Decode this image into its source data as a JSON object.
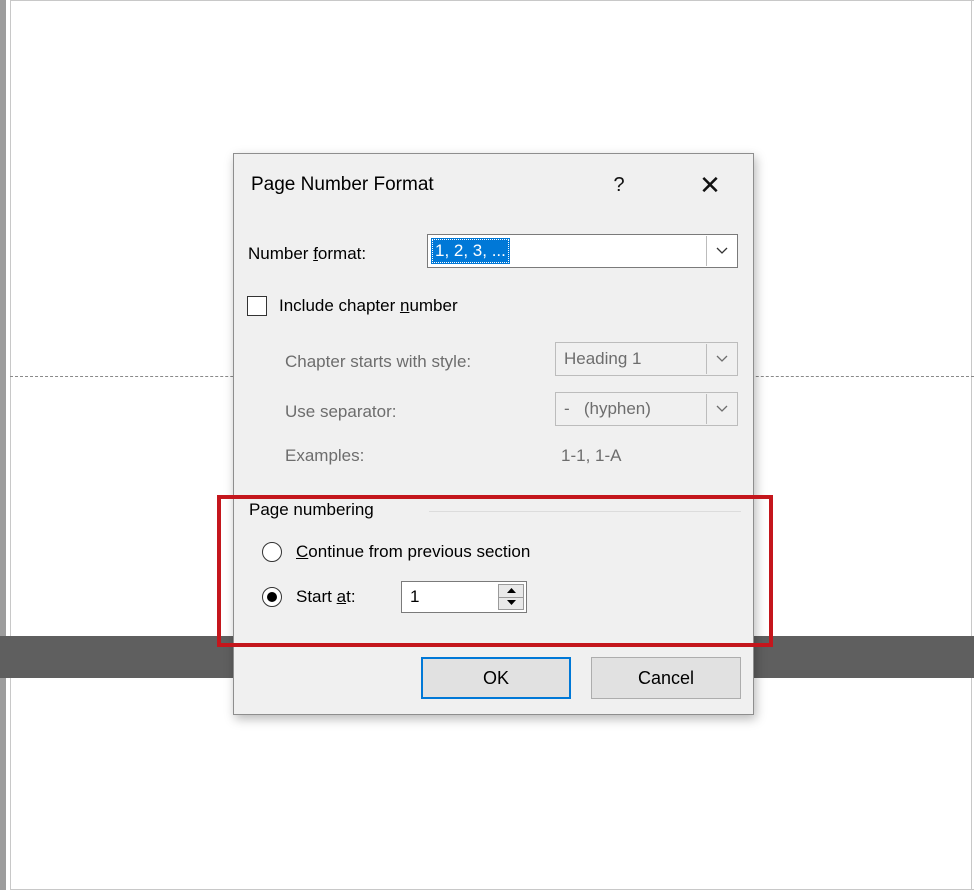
{
  "dialog": {
    "title": "Page Number Format",
    "help_label": "?",
    "close_label": "✕",
    "number_format": {
      "label_pre": "Number ",
      "label_accel": "f",
      "label_post": "ormat:",
      "value": "1, 2, 3, ..."
    },
    "include_chapter": {
      "label_pre": "Include chapter ",
      "label_accel": "n",
      "label_post": "umber",
      "checked": false
    },
    "chapter_style": {
      "label": "Chapter starts with style:",
      "value": "Heading 1"
    },
    "separator": {
      "label": "Use separator:",
      "value": "-   (hyphen)"
    },
    "examples": {
      "label": "Examples:",
      "value": "1-1, 1-A"
    },
    "page_numbering": {
      "group_title": "Page numbering",
      "continue": {
        "label_accel": "C",
        "label_post": "ontinue from previous section",
        "selected": false
      },
      "start_at": {
        "label_pre": "Start ",
        "label_accel": "a",
        "label_post": "t:",
        "selected": true,
        "value": "1"
      }
    },
    "buttons": {
      "ok": "OK",
      "cancel": "Cancel"
    }
  },
  "colors": {
    "annotation": "#c4161c",
    "selection": "#0078d7",
    "dialog_bg": "#f0f0f0"
  },
  "icons": [
    "chevron-down-icon",
    "spin-up-icon",
    "spin-down-icon",
    "close-icon",
    "help-icon"
  ]
}
